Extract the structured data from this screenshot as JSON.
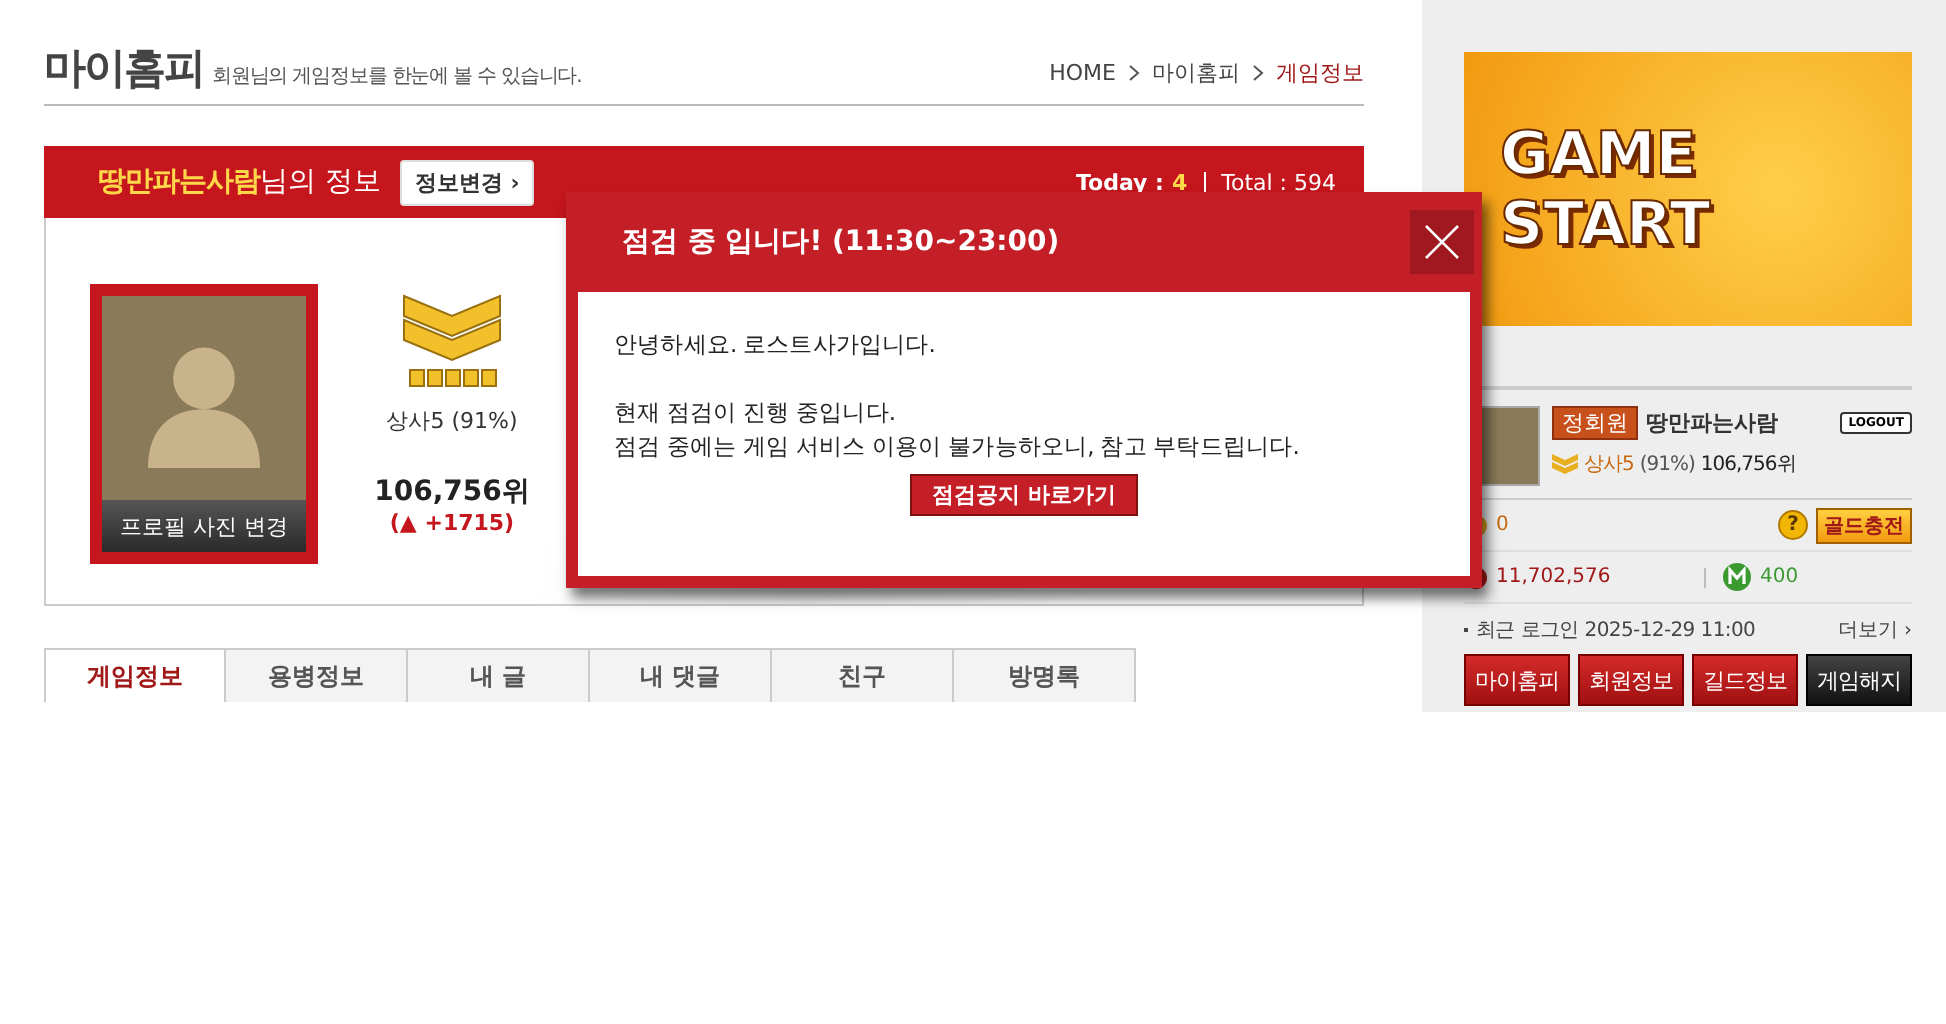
{
  "header": {
    "title": "마이홈피",
    "subtitle": "회원님의 게임정보를 한눈에 볼 수 있습니다.",
    "breadcrumb": [
      {
        "label": "HOME",
        "current": false
      },
      {
        "label": "마이홈피",
        "current": false
      },
      {
        "label": "게임정보",
        "current": true
      }
    ]
  },
  "info_bar": {
    "user_name": "땅만파는사람",
    "suffix": "님의 정보",
    "edit_button": "정보변경 ›",
    "today_label": "Today :",
    "today_value": "4",
    "total_label": "Total : 594"
  },
  "profile": {
    "photo_button": "프로필 사진 변경",
    "rank_name": "상사5 (91%)",
    "ranking": "106,756위",
    "rank_change": "(▲ +1715)"
  },
  "tabs": [
    {
      "label": "게임정보",
      "selected": true
    },
    {
      "label": "용병정보",
      "selected": false
    },
    {
      "label": "내 글",
      "selected": false
    },
    {
      "label": "내 댓글",
      "selected": false
    },
    {
      "label": "친구",
      "selected": false
    },
    {
      "label": "방명록",
      "selected": false
    }
  ],
  "sidebar": {
    "banner": "GAME START",
    "badge": "정회원",
    "user_name": "땅만파는사람",
    "logout": "LOGOUT",
    "rank": "상사5",
    "rank_percent": "(91%)",
    "ranking": "106,756위",
    "gold": "0",
    "gold_button": "골드충전",
    "help": "?",
    "points": "11,702,576",
    "mileage": "400",
    "last_login": "최근 로그인 2025-12-29 11:00",
    "more": "더보기 ›",
    "buttons": [
      {
        "label": "마이홈피",
        "kind": "red"
      },
      {
        "label": "회원정보",
        "kind": "red"
      },
      {
        "label": "길드정보",
        "kind": "red"
      },
      {
        "label": "게임해지",
        "kind": "dark"
      }
    ]
  },
  "dialog": {
    "title": "점검 중 입니다! (11:30~23:00)",
    "greeting": "안녕하세요. 로스트사가입니다.",
    "lines": [
      "현재 점검이 진행 중입니다.",
      "점검 중에는 게임 서비스 이용이 불가능하오니, 참고 부탁드립니다."
    ],
    "button": "점검공지 바로가기"
  }
}
